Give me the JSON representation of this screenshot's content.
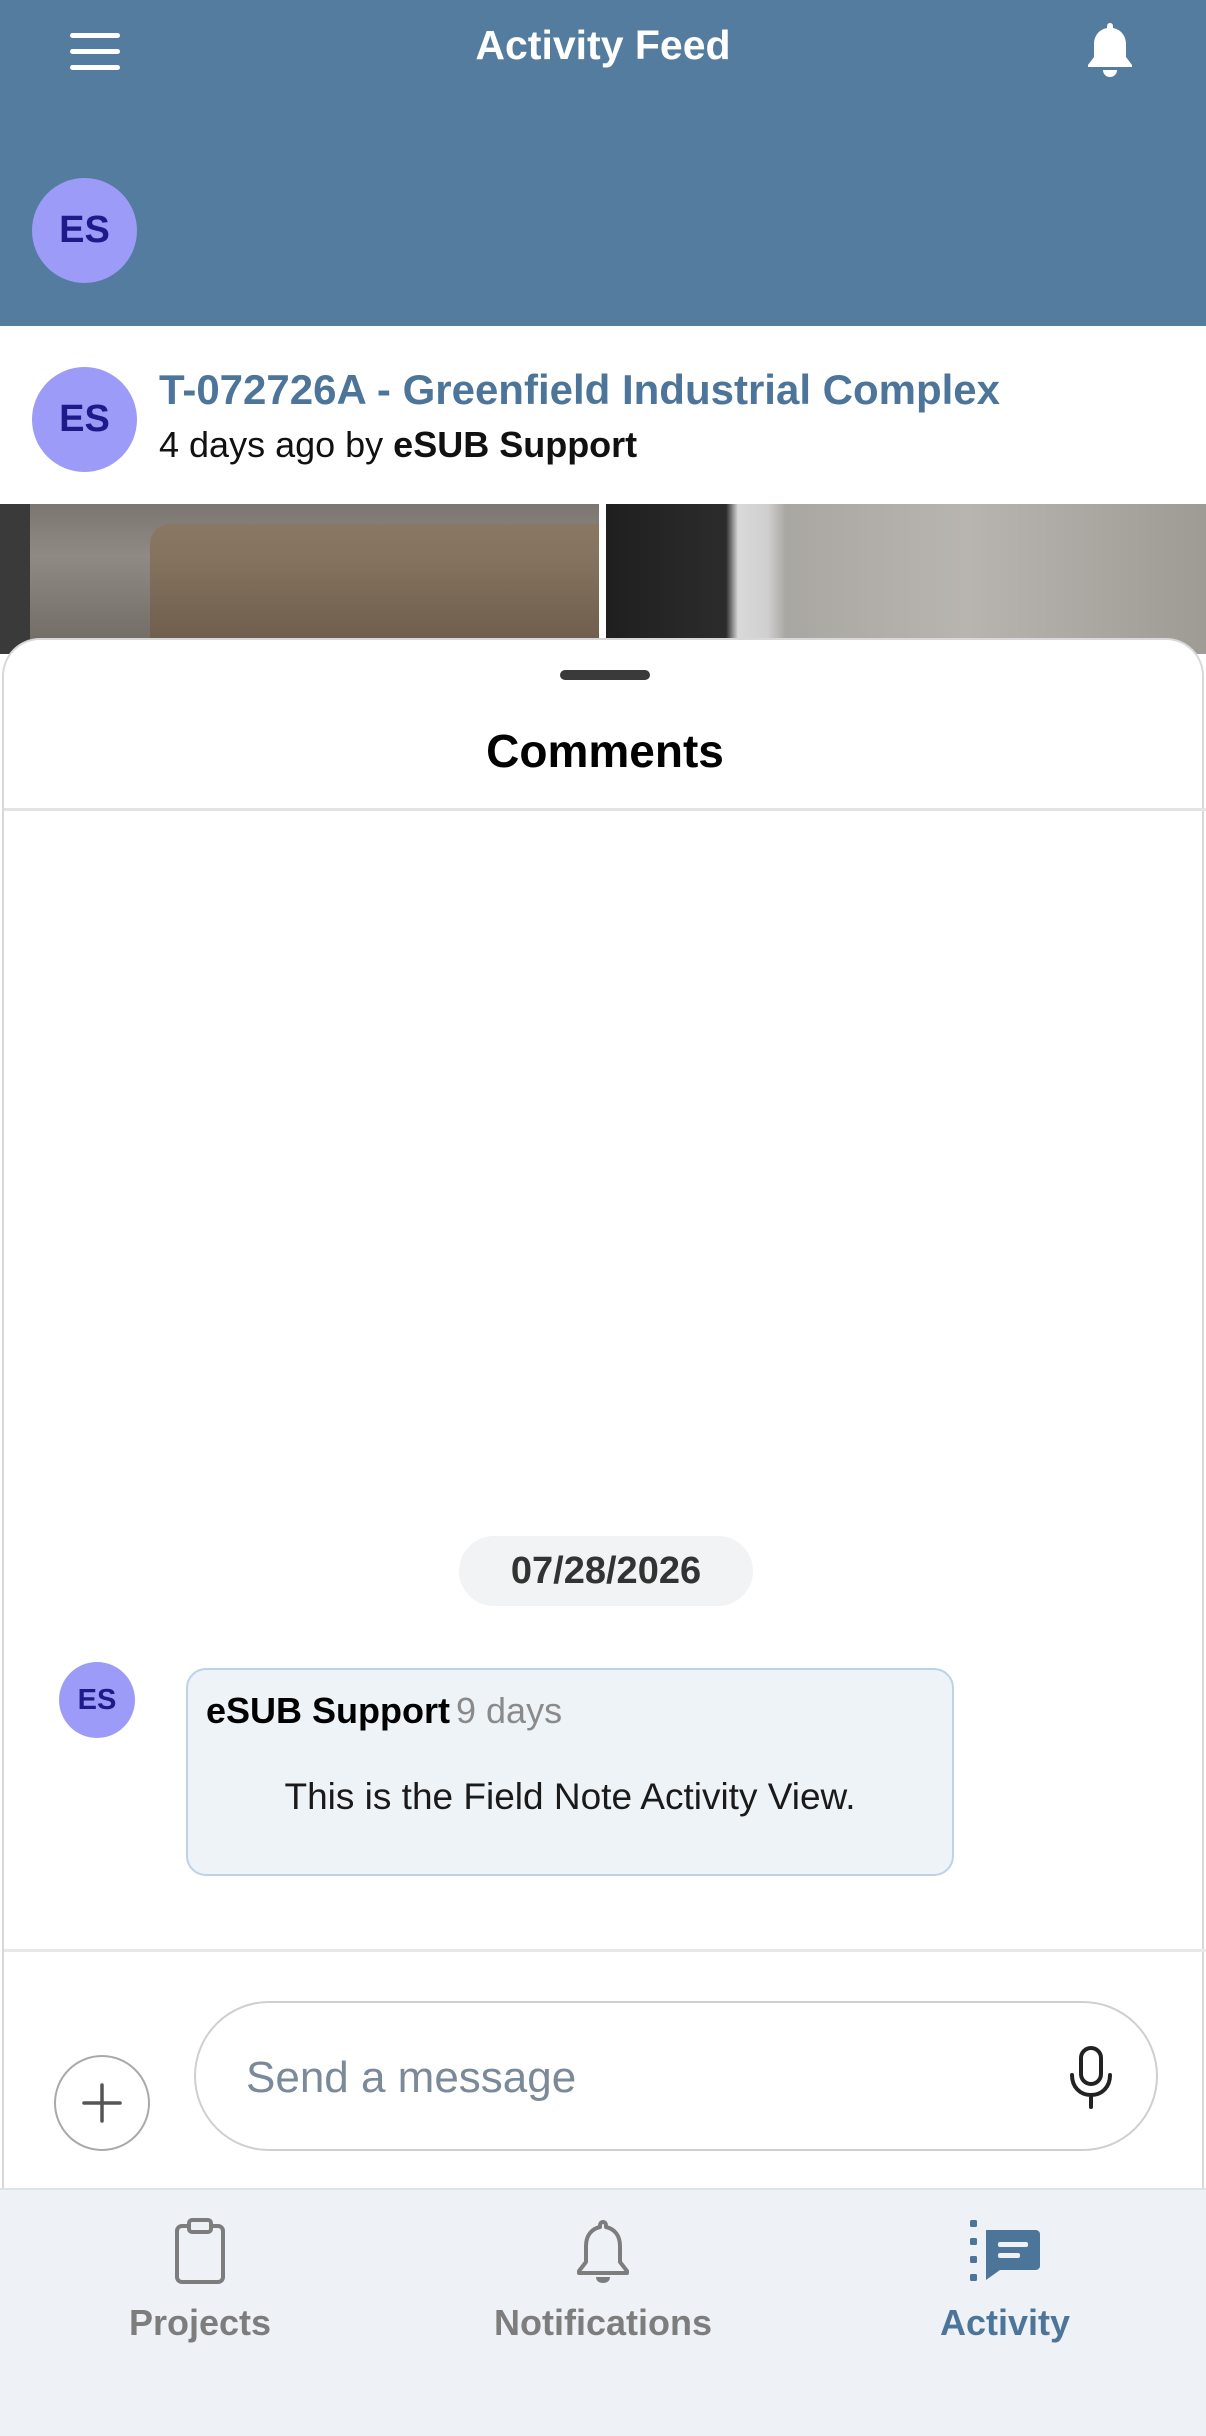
{
  "header": {
    "title": "Activity Feed",
    "avatar_initials": "ES",
    "menu_icon": "hamburger-menu-icon",
    "bell_icon": "bell-icon"
  },
  "post": {
    "avatar_initials": "ES",
    "title": "T-072726A - Greenfield Industrial Complex",
    "meta_prefix": "4 days ago by",
    "author": "eSUB Support"
  },
  "comments": {
    "title": "Comments",
    "date_chip": "07/28/2026",
    "items": [
      {
        "avatar_initials": "ES",
        "author": "eSUB Support",
        "time": "9 days",
        "text": "This is the Field Note Activity View."
      }
    ],
    "input_placeholder": "Send a message"
  },
  "tabbar": {
    "tabs": [
      {
        "label": "Projects",
        "icon": "clipboard-icon",
        "active": false
      },
      {
        "label": "Notifications",
        "icon": "bell-icon",
        "active": false
      },
      {
        "label": "Activity",
        "icon": "activity-feed-icon",
        "active": true
      }
    ]
  },
  "colors": {
    "header_bg": "#537c9e",
    "accent": "#4d7599",
    "avatar_bg": "#9c9bf7",
    "avatar_text": "#1d1a8a",
    "bubble_bg": "#eef3f8",
    "tabbar_bg": "#eef2f6"
  }
}
